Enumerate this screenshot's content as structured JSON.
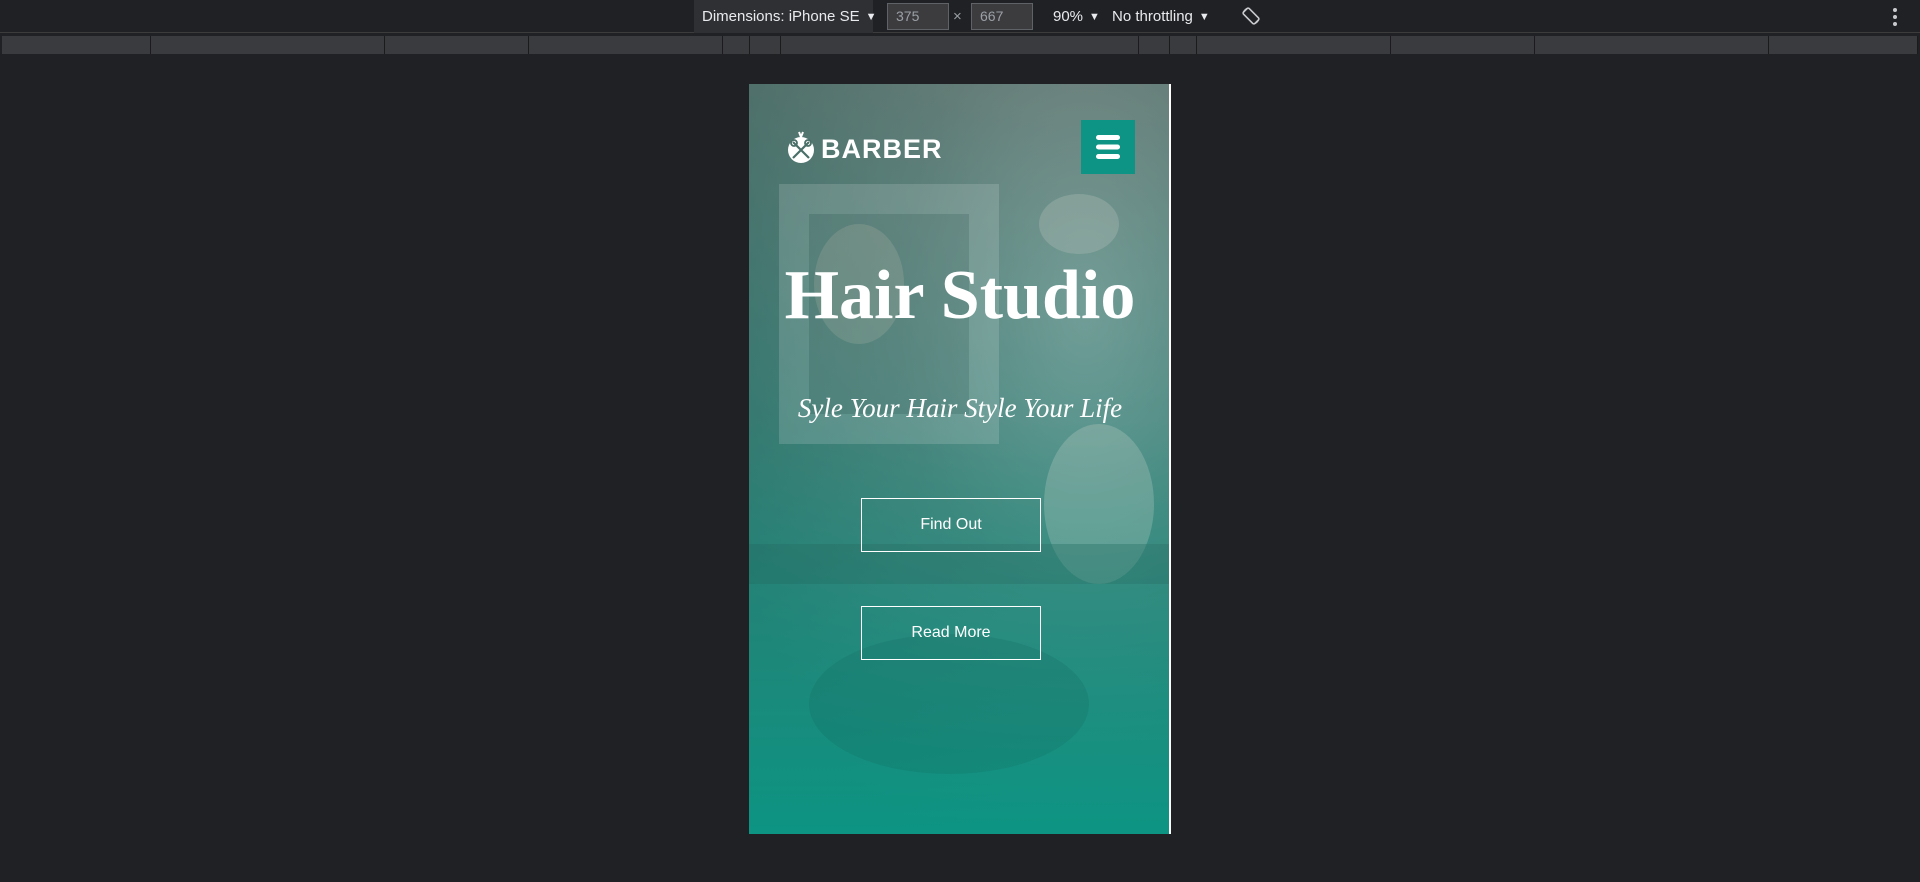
{
  "devtools": {
    "dimensions_label": "Dimensions: iPhone SE",
    "width_value": "375",
    "height_value": "667",
    "times_symbol": "×",
    "zoom_label": "90%",
    "throttling_label": "No throttling",
    "caret": "▼"
  },
  "site": {
    "brand": "BARBER",
    "hero_title": "Hair Studio",
    "hero_tagline": "Syle Your Hair Style Your Life",
    "primary_button": "Find Out",
    "secondary_button": "Read More"
  },
  "colors": {
    "accent": "#0d9484",
    "devtools_bg": "#202124"
  },
  "icons": {
    "logo": "barber-scissors-icon",
    "menu": "hamburger-icon",
    "rotate": "rotate-device-icon",
    "more": "more-vertical-icon"
  }
}
